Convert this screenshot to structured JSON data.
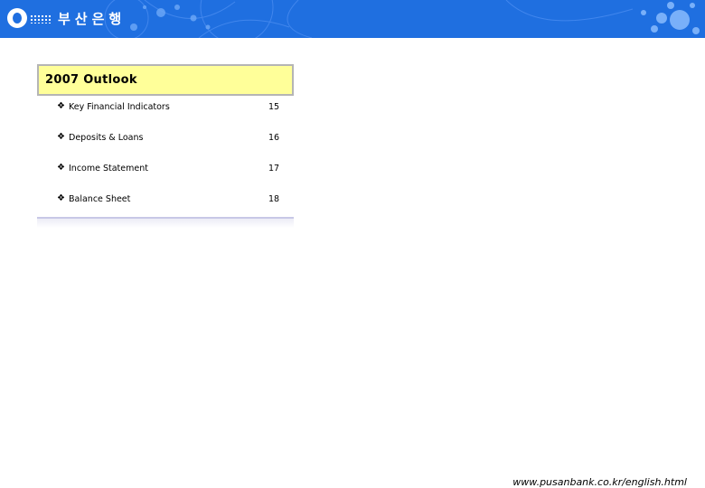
{
  "header": {
    "bank_name": "부산은행",
    "logo_icon": "pusanbank-logo-icon",
    "background_color": "#1f6fe0"
  },
  "section": {
    "title": "2007 Outlook",
    "title_background": "#ffff99",
    "items": [
      {
        "label": "Key Financial Indicators",
        "page": "15"
      },
      {
        "label": "Deposits & Loans",
        "page": "16"
      },
      {
        "label": "Income Statement",
        "page": "17"
      },
      {
        "label": "Balance Sheet",
        "page": "18"
      }
    ],
    "bullet_glyph": "❖"
  },
  "footer": {
    "url": "www.pusanbank.co.kr/english.html"
  }
}
